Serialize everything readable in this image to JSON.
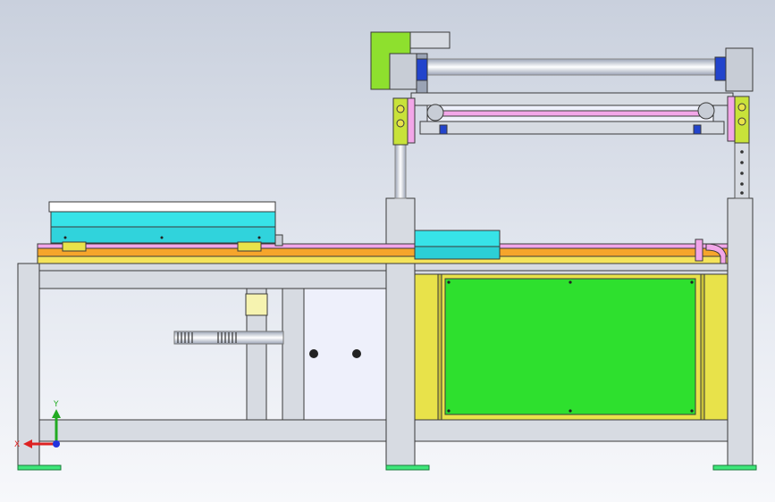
{
  "view": {
    "background_top": "#c9d0dd",
    "background_bottom": "#f7f8fb"
  },
  "triad": {
    "y_label": "Y",
    "x_label": "X",
    "y_color": "#22aa22",
    "x_color": "#dd2222",
    "z_color": "#2233dd"
  },
  "colors": {
    "frame": "#d7dbe2",
    "frame_edge": "#3a3a3a",
    "yellow_panel": "#e8e24a",
    "green_panel": "#2ee02e",
    "cyan_block": "#37e3e8",
    "orange_rail": "#f6a52b",
    "pink_rail": "#f2a6e8",
    "lime_part": "#8ee02e",
    "white_door": "#eef0fb",
    "feet": "#3ee67a"
  }
}
